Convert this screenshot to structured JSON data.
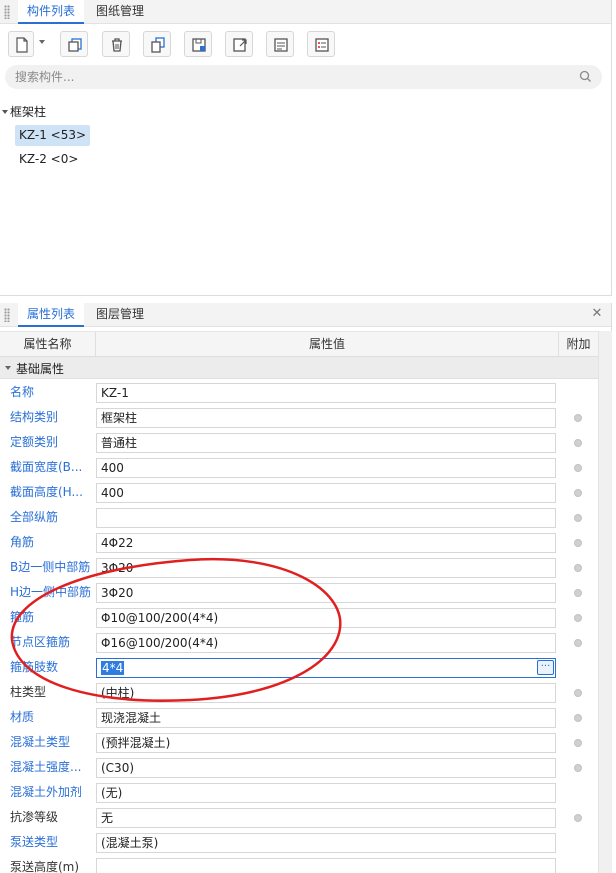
{
  "top_panel": {
    "tabs": [
      "构件列表",
      "图纸管理"
    ],
    "active_tab": 0,
    "toolbar": {
      "buttons": [
        "new-icon",
        "copy-icon",
        "delete-icon",
        "duplicate-icon",
        "save-floor-icon",
        "export-icon",
        "list-icon",
        "properties-icon"
      ]
    },
    "search": {
      "placeholder": "搜索构件..."
    },
    "tree": {
      "root": "框架柱",
      "items": [
        {
          "label": "KZ-1 <53>",
          "selected": true
        },
        {
          "label": "KZ-2 <0>",
          "selected": false
        }
      ]
    }
  },
  "bottom_panel": {
    "tabs": [
      "属性列表",
      "图层管理"
    ],
    "active_tab": 0,
    "columns": {
      "name": "属性名称",
      "value": "属性值",
      "extra": "附加"
    },
    "section": "基础属性",
    "rows": [
      {
        "name": "名称",
        "value": "KZ-1",
        "blue": true,
        "dot": false
      },
      {
        "name": "结构类别",
        "value": "框架柱",
        "blue": true,
        "dot": true
      },
      {
        "name": "定额类别",
        "value": "普通柱",
        "blue": true,
        "dot": true
      },
      {
        "name": "截面宽度(B...",
        "value": "400",
        "blue": true,
        "dot": true
      },
      {
        "name": "截面高度(H...",
        "value": "400",
        "blue": true,
        "dot": true
      },
      {
        "name": "全部纵筋",
        "value": "",
        "blue": true,
        "dot": true
      },
      {
        "name": "角筋",
        "value": "4Φ22",
        "blue": true,
        "dot": true
      },
      {
        "name": "B边一侧中部筋",
        "value": "3Φ20",
        "blue": true,
        "dot": true
      },
      {
        "name": "H边一侧中部筋",
        "value": "3Φ20",
        "blue": true,
        "dot": true
      },
      {
        "name": "箍筋",
        "value": "Φ10@100/200(4*4)",
        "blue": true,
        "dot": true
      },
      {
        "name": "节点区箍筋",
        "value": "Φ16@100/200(4*4)",
        "blue": true,
        "dot": true
      },
      {
        "name": "箍筋肢数",
        "value": "4*4",
        "blue": true,
        "dot": false,
        "editing": true
      },
      {
        "name": "柱类型",
        "value": "(中柱)",
        "blue": false,
        "dot": true
      },
      {
        "name": "材质",
        "value": "现浇混凝土",
        "blue": true,
        "dot": true
      },
      {
        "name": "混凝土类型",
        "value": "(预拌混凝土)",
        "blue": true,
        "dot": true
      },
      {
        "name": "混凝土强度...",
        "value": "(C30)",
        "blue": true,
        "dot": true
      },
      {
        "name": "混凝土外加剂",
        "value": "(无)",
        "blue": true,
        "dot": false
      },
      {
        "name": "抗渗等级",
        "value": "无",
        "blue": false,
        "dot": true
      },
      {
        "name": "泵送类型",
        "value": "(混凝土泵)",
        "blue": true,
        "dot": false
      },
      {
        "name": "泵送高度(m)",
        "value": "",
        "blue": false,
        "dot": false
      }
    ]
  },
  "colors": {
    "accent": "#2a6fd6",
    "annotation": "#e02020",
    "selection": "#cfe3f7"
  }
}
